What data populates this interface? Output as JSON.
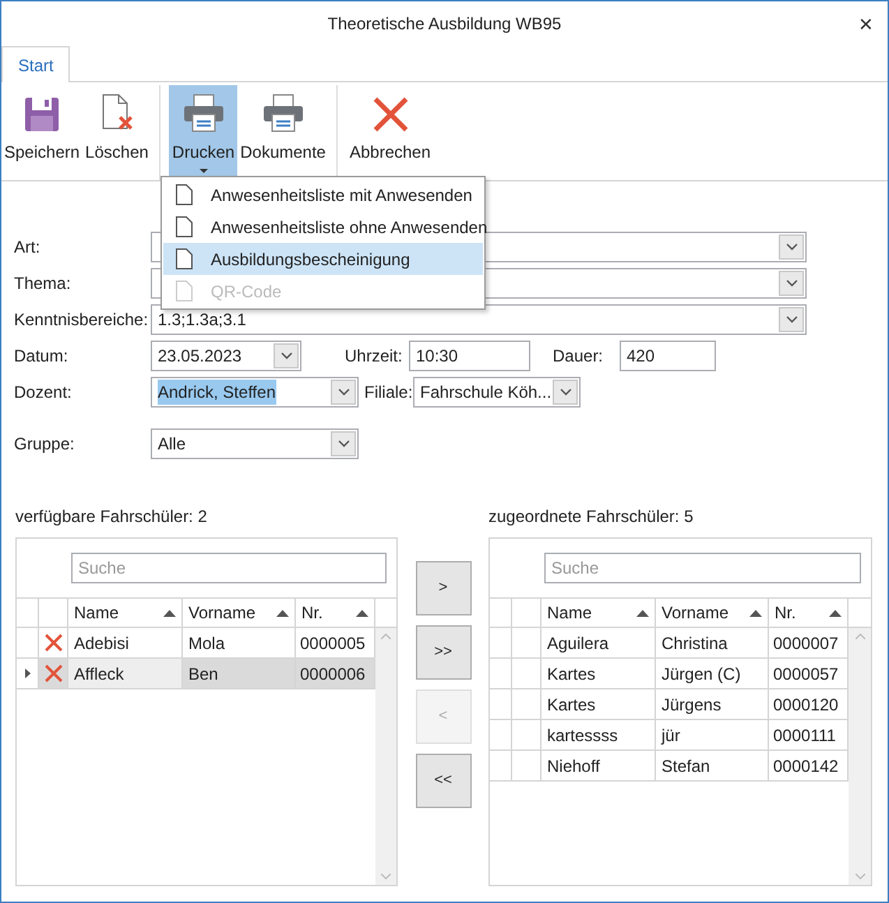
{
  "window": {
    "title": "Theoretische Ausbildung WB95",
    "close": "✕"
  },
  "tabs": [
    {
      "label": "Start",
      "selected": true
    }
  ],
  "ribbon": [
    {
      "label": "Speichern",
      "kind": "save",
      "selected": false,
      "dropdown": false
    },
    {
      "label": "Löschen",
      "kind": "delete",
      "selected": false,
      "dropdown": false
    },
    {
      "label": "Drucken",
      "kind": "print",
      "selected": true,
      "dropdown": true
    },
    {
      "label": "Dokumente",
      "kind": "print",
      "selected": false,
      "dropdown": false
    },
    {
      "label": "Abbrechen",
      "kind": "cancel",
      "selected": false,
      "dropdown": false
    }
  ],
  "print_menu": [
    {
      "label": "Anwesenheitsliste mit Anwesenden",
      "selected": false,
      "disabled": false
    },
    {
      "label": "Anwesenheitsliste ohne Anwesenden",
      "selected": false,
      "disabled": false
    },
    {
      "label": "Ausbildungsbescheinigung",
      "selected": true,
      "disabled": false
    },
    {
      "label": "QR-Code",
      "selected": false,
      "disabled": true
    }
  ],
  "form": {
    "art": {
      "label": "Art:"
    },
    "thema": {
      "label": "Thema:"
    },
    "kenntnisbereiche": {
      "label": "Kenntnisbereiche:",
      "value": "1.3;1.3a;3.1"
    },
    "datum": {
      "label": "Datum:",
      "value": "23.05.2023"
    },
    "uhrzeit": {
      "label": "Uhrzeit:",
      "value": "10:30"
    },
    "dauer": {
      "label": "Dauer:",
      "value": "420"
    },
    "dozent": {
      "label": "Dozent:",
      "value": "Andrick, Steffen",
      "text_selected": true
    },
    "filiale": {
      "label": "Filiale:",
      "value": "Fahrschule Köh..."
    },
    "gruppe": {
      "label": "Gruppe:",
      "value": "Alle"
    }
  },
  "available": {
    "label": "verfügbare Fahrschüler:",
    "count": "2",
    "search": {
      "placeholder": "Suche"
    },
    "columns": [
      "Name",
      "Vorname",
      "Nr."
    ],
    "rows": [
      {
        "name": "Adebisi",
        "vorname": "Mola",
        "nr": "0000005",
        "removable": true,
        "selected": false
      },
      {
        "name": "Affleck",
        "vorname": "Ben",
        "nr": "0000006",
        "removable": true,
        "selected": true
      }
    ]
  },
  "move_buttons": [
    {
      "label": ">",
      "disabled": false
    },
    {
      "label": ">>",
      "disabled": false
    },
    {
      "label": "<",
      "disabled": true
    },
    {
      "label": "<<",
      "disabled": false
    }
  ],
  "assigned": {
    "label": "zugeordnete Fahrschüler:",
    "count": "5",
    "search": {
      "placeholder": "Suche"
    },
    "columns": [
      "Name",
      "Vorname",
      "Nr."
    ],
    "rows": [
      {
        "name": "Aguilera",
        "vorname": "Christina",
        "nr": "0000007",
        "removable": false,
        "selected": false
      },
      {
        "name": "Kartes",
        "vorname": "Jürgen (C)",
        "nr": "0000057",
        "removable": false,
        "selected": false
      },
      {
        "name": "Kartes",
        "vorname": "Jürgens",
        "nr": "0000120",
        "removable": false,
        "selected": false
      },
      {
        "name": "kartessss",
        "vorname": "jür",
        "nr": "0000111",
        "removable": false,
        "selected": false
      },
      {
        "name": "Niehoff",
        "vorname": "Stefan",
        "nr": "0000142",
        "removable": false,
        "selected": false
      }
    ]
  }
}
